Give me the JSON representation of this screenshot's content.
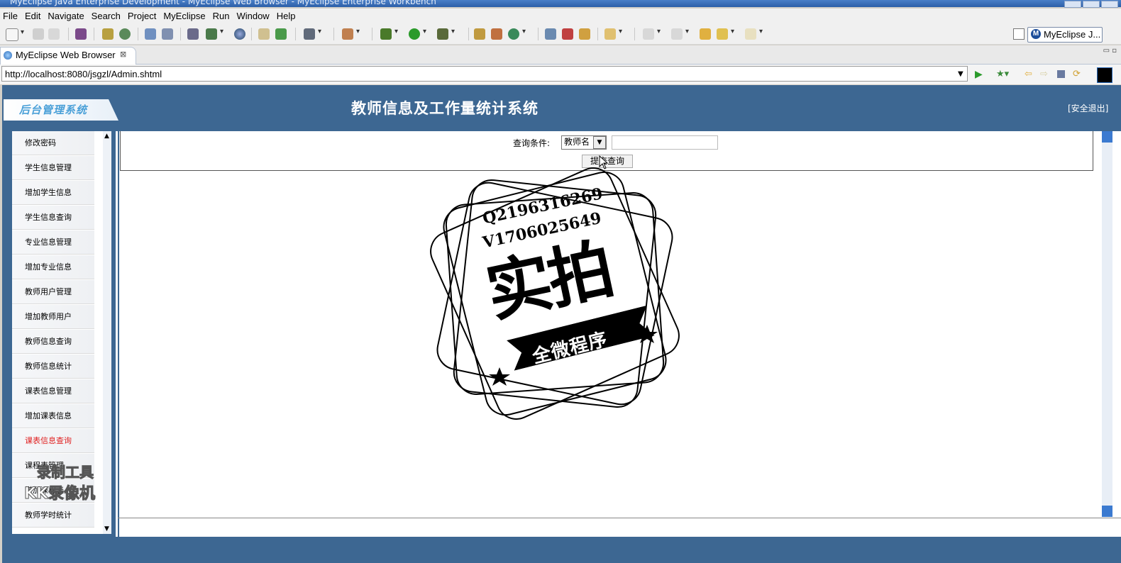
{
  "window": {
    "title": "MyEclipse Java Enterprise Development - MyEclipse Web Browser - MyEclipse Enterprise Workbench"
  },
  "menu": [
    "File",
    "Edit",
    "Navigate",
    "Search",
    "Project",
    "MyEclipse",
    "Run",
    "Window",
    "Help"
  ],
  "perspective": {
    "label": "MyEclipse J..."
  },
  "editor_tab": {
    "label": "MyEclipse Web Browser"
  },
  "browser": {
    "url": "http://localhost:8080/jsgzl/Admin.shtml"
  },
  "site": {
    "logo_text": "后台管理系统",
    "title": "教师信息及工作量统计系统",
    "logout": "[安全退出]"
  },
  "sidebar": {
    "items": [
      "修改密码",
      "学生信息管理",
      "增加学生信息",
      "学生信息查询",
      "专业信息管理",
      "增加专业信息",
      "教师用户管理",
      "增加教师用户",
      "教师信息查询",
      "教师信息统计",
      "课表信息管理",
      "增加课表信息",
      "课表信息查询",
      "课程表管理",
      "增加课程表",
      "教师学时统计"
    ],
    "active": "课表信息查询"
  },
  "query": {
    "label": "查询条件:",
    "selected_option": "教师名",
    "input_value": "",
    "submit": "提交查询"
  },
  "watermarks": {
    "stamp_line1": "Q2196316269",
    "stamp_line2": "V1706025649",
    "stamp_big": "实拍",
    "stamp_banner": "全微程序",
    "recorder_line1": "录制工具",
    "recorder_line2": "KK录像机"
  },
  "colors": {
    "header_blue": "#3d6792",
    "active_nav": "#e02020"
  }
}
